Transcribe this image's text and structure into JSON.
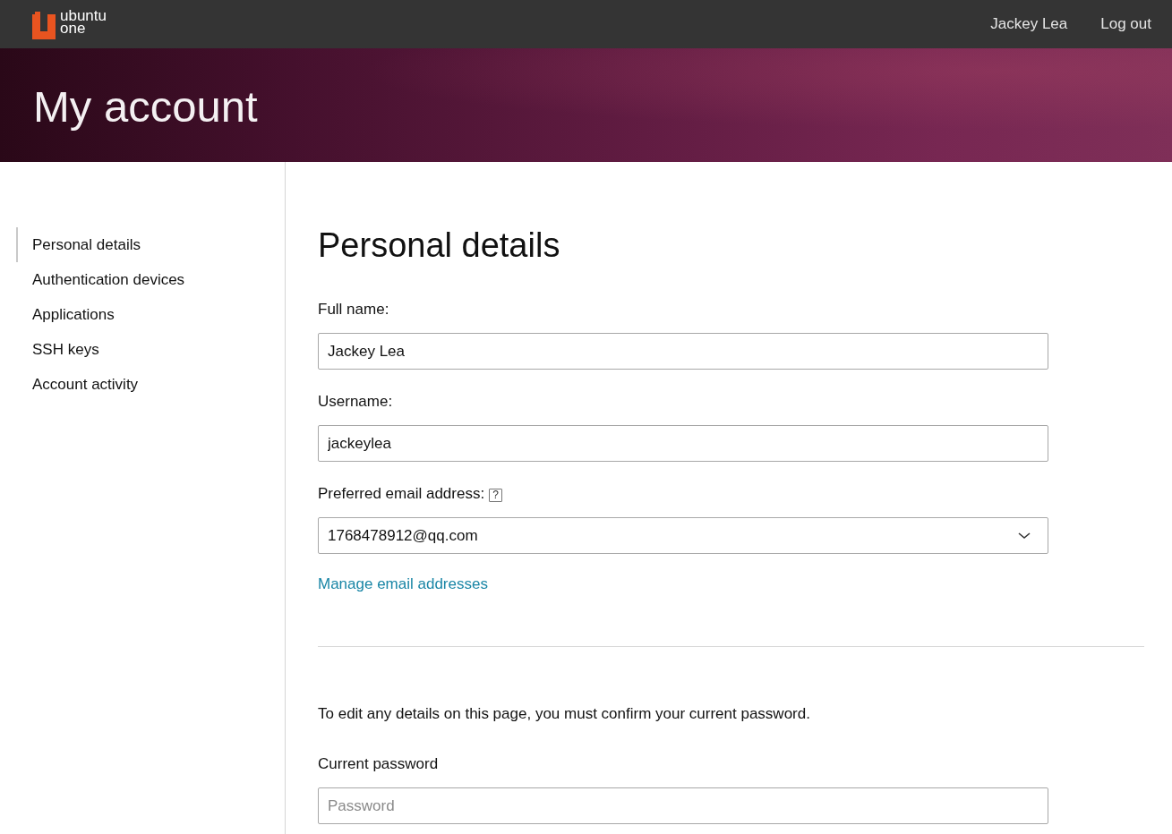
{
  "top_bar": {
    "brand": [
      "ubuntu",
      "one"
    ],
    "nav": [
      "Jackey Lea",
      "Log out"
    ]
  },
  "header": {
    "title": "My account"
  },
  "sidebar": {
    "items": [
      {
        "label": "Personal details",
        "selected": true
      },
      {
        "label": "Authentication devices",
        "selected": false
      },
      {
        "label": "Applications",
        "selected": false
      },
      {
        "label": "SSH keys",
        "selected": false
      },
      {
        "label": "Account activity",
        "selected": false
      }
    ]
  },
  "content": {
    "title": "Personal details",
    "fields": [
      {
        "kind": "text",
        "label": "Full name:",
        "value": "Jackey Lea"
      },
      {
        "kind": "text",
        "label": "Username:",
        "value": "jackeylea"
      },
      {
        "kind": "select",
        "label": "Preferred email address:",
        "help": "?",
        "value": "1768478912@qq.com"
      }
    ],
    "link": "Manage email addresses",
    "notice": "To edit any details on this page, you must confirm your current password.",
    "password": {
      "label": "Current password",
      "placeholder": "Password"
    }
  }
}
